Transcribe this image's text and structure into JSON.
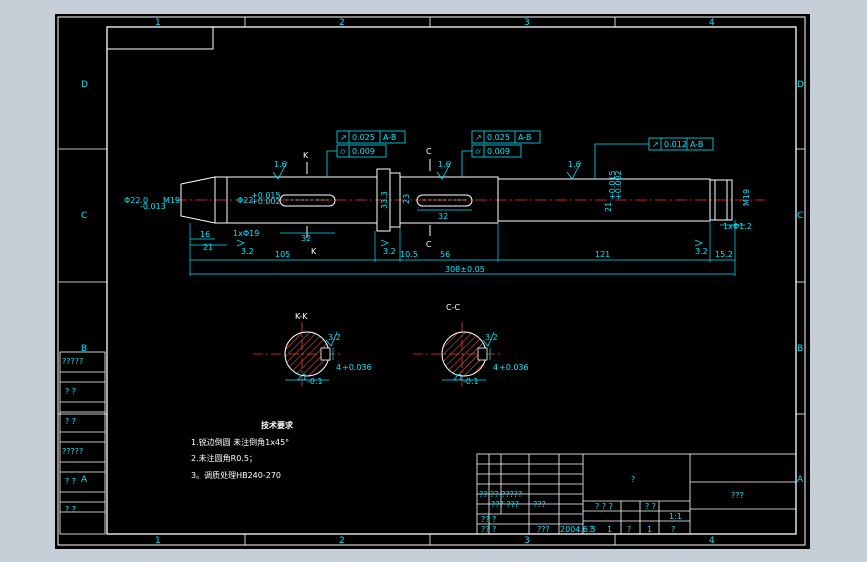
{
  "grid": {
    "cols": [
      "1",
      "2",
      "3",
      "4"
    ],
    "rows": [
      "D",
      "C",
      "B",
      "A"
    ]
  },
  "shaft": {
    "sections": [
      "K",
      "K",
      "C",
      "C"
    ],
    "tolerances": [
      {
        "symbol": "↗",
        "value": "0.025",
        "datum": "A-B"
      },
      {
        "symbol": "⌭",
        "value": "0.009"
      },
      {
        "symbol": "↗",
        "value": "0.025",
        "datum": "A-B"
      },
      {
        "symbol": "⌭",
        "value": "0.009"
      },
      {
        "symbol": "↗",
        "value": "0.012",
        "datum": "A-B"
      }
    ],
    "roughness": [
      "1.6",
      "1.6",
      "1.6",
      "3.2",
      "3.2",
      "3.2"
    ],
    "diameters": {
      "left_end": "Φ22.0",
      "left_end_tol": "-0.013",
      "left_thread": "M19",
      "journal1": "Φ22",
      "journal1_tol1": "+0.015",
      "journal1_tol2": "+0.002",
      "collar": "33.3",
      "journal2": "23",
      "journal3": "21",
      "journal3_tol1": "+0.015",
      "journal3_tol2": "+0.002",
      "right_thread": "M19"
    },
    "dims": {
      "d16": "16",
      "d21": "21",
      "chamfer_left": "1xΦ19",
      "d105": "105",
      "key1": "32",
      "d10_5": "10.5",
      "d56": "56",
      "key2": "32",
      "d121": "121",
      "d15_2": "15.2",
      "chamfer_right": "1xΦ1.2",
      "overall": "308±0.05"
    }
  },
  "section_views": [
    {
      "title": "K-K",
      "roughness": "3.2",
      "width": "21",
      "width_tol": "-0.1",
      "key": "4",
      "key_tol": "+0.036"
    },
    {
      "title": "C-C",
      "roughness": "3.2",
      "width": "21",
      "width_tol": "-0.1",
      "key": "4",
      "key_tol": "+0.036"
    }
  ],
  "notes": {
    "title": "技术要求",
    "lines": [
      "1.锐边倒圆    未注倒角1x45°",
      "2.未注圆角R0.5；",
      "3。调质处理HB240-270"
    ]
  },
  "left_strip": {
    "labels": [
      "?????",
      "?  ?",
      "?  ?",
      "?????",
      "?  ?",
      "?  ?"
    ]
  },
  "title_block": {
    "name": "?",
    "drawing_no": "???",
    "rows": [
      "?? ??  ?????",
      "???  ???",
      "?? ?",
      "?? ?",
      "?? ?"
    ],
    "scale_row": [
      "? ? ?",
      "? ?"
    ],
    "scale": "1:1",
    "sheet_row": [
      "?",
      "1",
      "?",
      "1",
      "?"
    ],
    "date": "2004.6.3",
    "sign": "???",
    "std": "???"
  }
}
